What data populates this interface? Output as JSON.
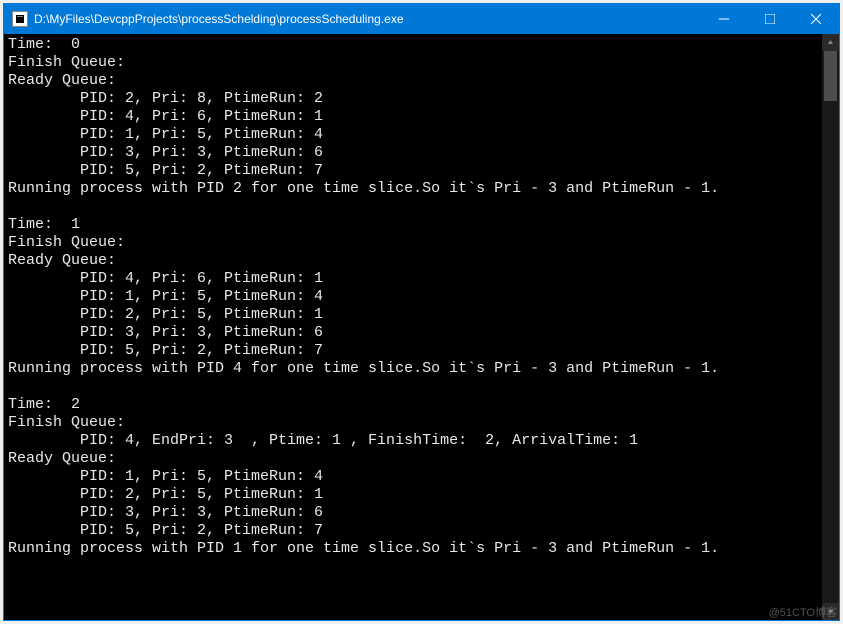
{
  "window": {
    "title": "D:\\MyFiles\\DevcppProjects\\processSchelding\\processScheduling.exe"
  },
  "steps": [
    {
      "time": 0,
      "finish": [],
      "ready": [
        {
          "pid": 2,
          "pri": 8,
          "ptimerun": 2
        },
        {
          "pid": 4,
          "pri": 6,
          "ptimerun": 1
        },
        {
          "pid": 1,
          "pri": 5,
          "ptimerun": 4
        },
        {
          "pid": 3,
          "pri": 3,
          "ptimerun": 6
        },
        {
          "pid": 5,
          "pri": 2,
          "ptimerun": 7
        }
      ],
      "run": {
        "pid": 2,
        "pri_delta": 3,
        "ptimerun_delta": 1
      }
    },
    {
      "time": 1,
      "finish": [],
      "ready": [
        {
          "pid": 4,
          "pri": 6,
          "ptimerun": 1
        },
        {
          "pid": 1,
          "pri": 5,
          "ptimerun": 4
        },
        {
          "pid": 2,
          "pri": 5,
          "ptimerun": 1
        },
        {
          "pid": 3,
          "pri": 3,
          "ptimerun": 6
        },
        {
          "pid": 5,
          "pri": 2,
          "ptimerun": 7
        }
      ],
      "run": {
        "pid": 4,
        "pri_delta": 3,
        "ptimerun_delta": 1
      }
    },
    {
      "time": 2,
      "finish": [
        {
          "pid": 4,
          "endpri": 3,
          "ptime": 1,
          "finishtime": 2,
          "arrivaltime": 1
        }
      ],
      "ready": [
        {
          "pid": 1,
          "pri": 5,
          "ptimerun": 4
        },
        {
          "pid": 2,
          "pri": 5,
          "ptimerun": 1
        },
        {
          "pid": 3,
          "pri": 3,
          "ptimerun": 6
        },
        {
          "pid": 5,
          "pri": 2,
          "ptimerun": 7
        }
      ],
      "run": {
        "pid": 1,
        "pri_delta": 3,
        "ptimerun_delta": 1
      }
    }
  ],
  "labels": {
    "time": "Time: ",
    "finish_queue": "Finish Queue:",
    "ready_queue": "Ready Queue:",
    "pid": "PID: ",
    "pri": "Pri: ",
    "ptimerun": "PtimeRun: ",
    "endpri": "EndPri: ",
    "ptime": "Ptime: ",
    "finishtime": "FinishTime: ",
    "arrivaltime": "ArrivalTime: ",
    "run_prefix": "Running process with PID ",
    "run_mid": " for one time slice.So it`s Pri - ",
    "run_and": " and PtimeRun - ",
    "run_end": "."
  },
  "watermark": "@51CTO博客"
}
